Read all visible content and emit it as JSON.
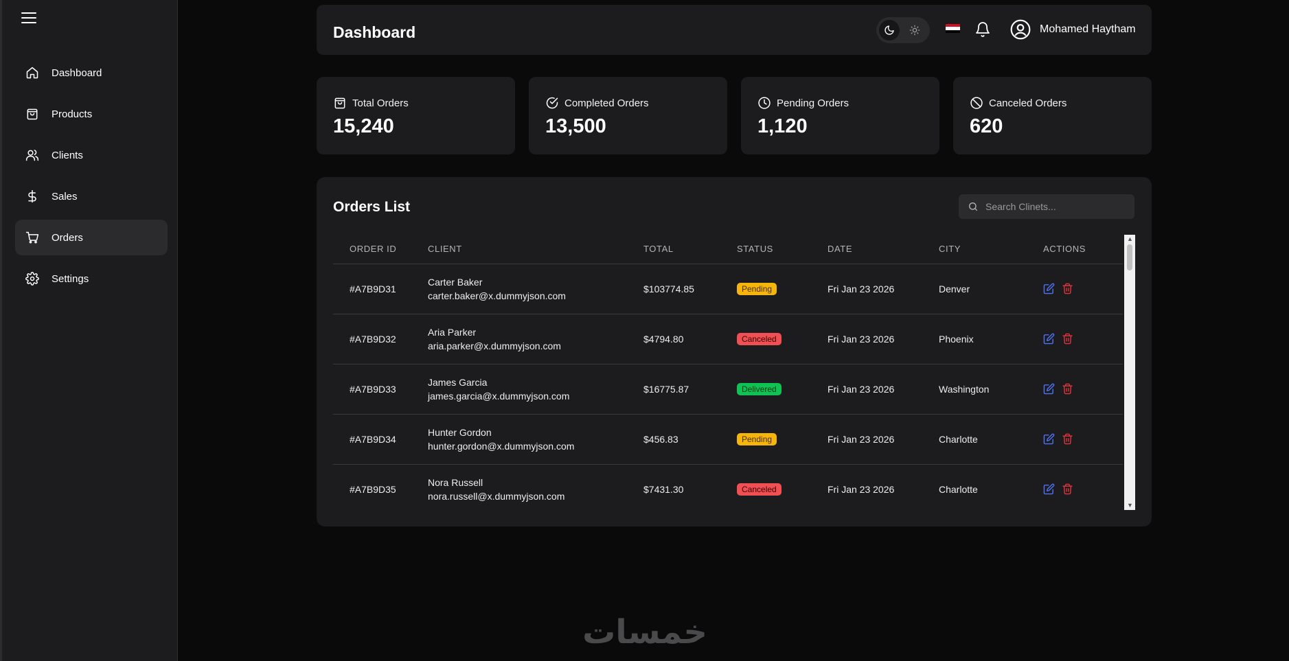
{
  "sidebar": {
    "items": [
      {
        "label": "Dashboard",
        "icon": "home-icon",
        "active": false
      },
      {
        "label": "Products",
        "icon": "shopping-bag-icon",
        "active": false
      },
      {
        "label": "Clients",
        "icon": "users-icon",
        "active": false
      },
      {
        "label": "Sales",
        "icon": "dollar-icon",
        "active": false
      },
      {
        "label": "Orders",
        "icon": "cart-icon",
        "active": true
      },
      {
        "label": "Settings",
        "icon": "gear-icon",
        "active": false
      }
    ]
  },
  "header": {
    "title": "Dashboard",
    "user_name": "Mohamed Haytham",
    "flag_colors": [
      "#ce1126",
      "#ffffff",
      "#000000"
    ]
  },
  "stats": [
    {
      "label": "Total Orders",
      "value": "15,240",
      "icon": "bag-icon"
    },
    {
      "label": "Completed Orders",
      "value": "13,500",
      "icon": "check-circle-icon"
    },
    {
      "label": "Pending Orders",
      "value": "1,120",
      "icon": "clock-icon"
    },
    {
      "label": "Canceled Orders",
      "value": "620",
      "icon": "ban-icon"
    }
  ],
  "orders": {
    "title": "Orders List",
    "search_placeholder": "Search Clinets...",
    "columns": [
      "ORDER ID",
      "CLIENT",
      "TOTAL",
      "STATUS",
      "DATE",
      "CITY",
      "ACTIONS"
    ],
    "rows": [
      {
        "id": "#A7B9D31",
        "name": "Carter Baker",
        "email": "carter.baker@x.dummyjson.com",
        "total": "$103774.85",
        "status": "Pending",
        "date": "Fri Jan 23 2026",
        "city": "Denver"
      },
      {
        "id": "#A7B9D32",
        "name": "Aria Parker",
        "email": "aria.parker@x.dummyjson.com",
        "total": "$4794.80",
        "status": "Canceled",
        "date": "Fri Jan 23 2026",
        "city": "Phoenix"
      },
      {
        "id": "#A7B9D33",
        "name": "James Garcia",
        "email": "james.garcia@x.dummyjson.com",
        "total": "$16775.87",
        "status": "Delivered",
        "date": "Fri Jan 23 2026",
        "city": "Washington"
      },
      {
        "id": "#A7B9D34",
        "name": "Hunter Gordon",
        "email": "hunter.gordon@x.dummyjson.com",
        "total": "$456.83",
        "status": "Pending",
        "date": "Fri Jan 23 2026",
        "city": "Charlotte"
      },
      {
        "id": "#A7B9D35",
        "name": "Nora Russell",
        "email": "nora.russell@x.dummyjson.com",
        "total": "$7431.30",
        "status": "Canceled",
        "date": "Fri Jan 23 2026",
        "city": "Charlotte"
      }
    ]
  },
  "status_colors": {
    "Pending": {
      "bg": "#f5b50a",
      "fg": "#4a2f00"
    },
    "Canceled": {
      "bg": "#f04f53",
      "fg": "#3a0000"
    },
    "Delivered": {
      "bg": "#10c153",
      "fg": "#003a14"
    }
  },
  "colors": {
    "edit": "#4f73f5",
    "delete": "#e0343a"
  },
  "watermark": "خمسات"
}
